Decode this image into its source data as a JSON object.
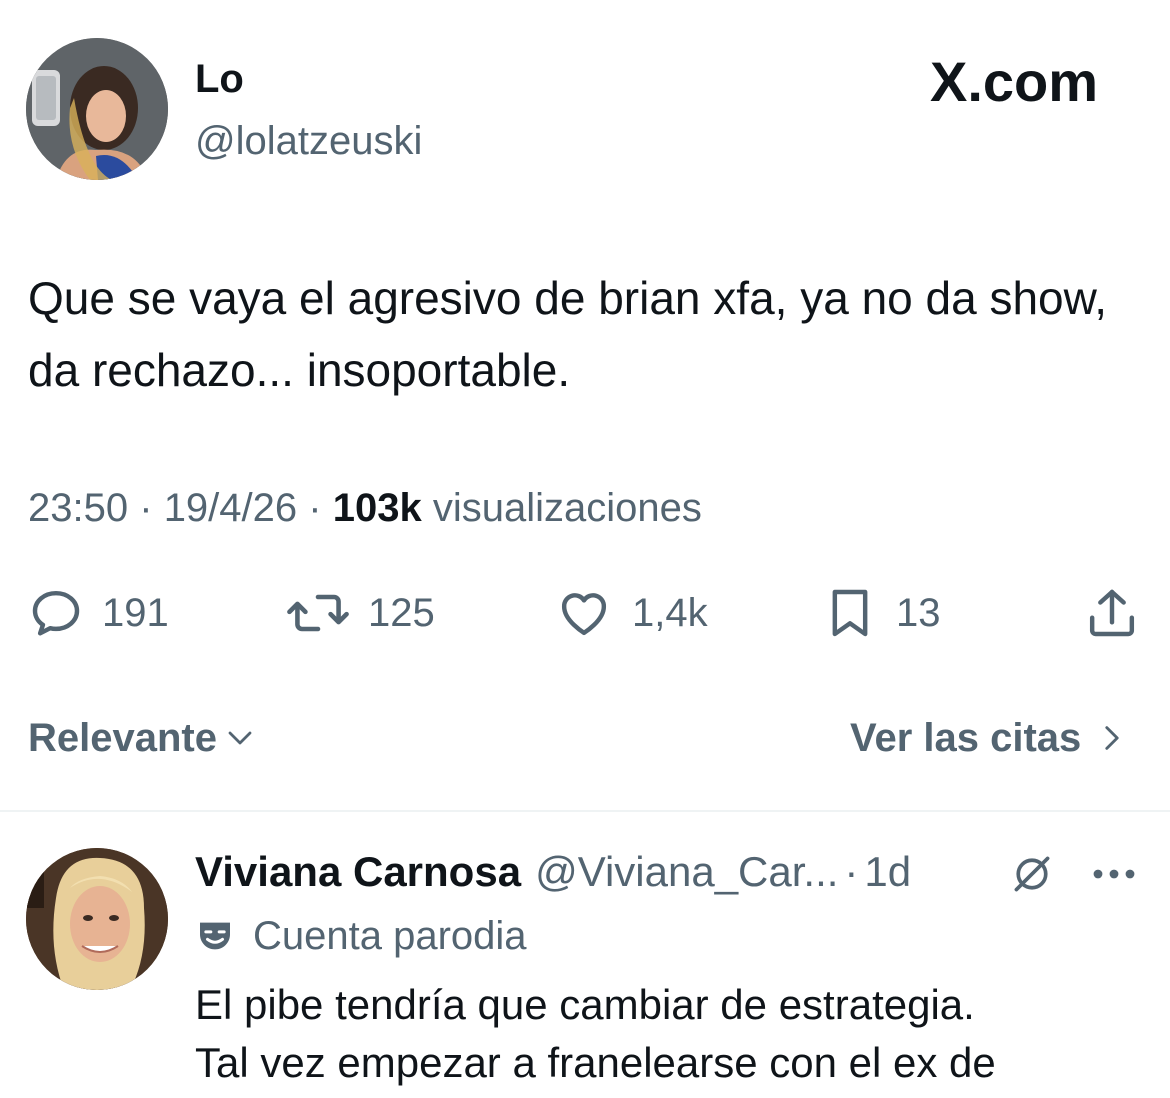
{
  "tweet": {
    "author_name": "Lo",
    "author_handle": "@lolatzeuski",
    "brand": "X.com",
    "text": "Que se vaya el agresivo de brian xfa, ya no da show, da rechazo... insoportable.",
    "time": "23:50",
    "date": "19/4/26",
    "separator": "·",
    "views_count": "103k",
    "views_label": "visualizaciones",
    "actions": {
      "replies": "191",
      "reposts": "125",
      "likes": "1,4k",
      "bookmarks": "13"
    },
    "icons": {
      "reply": "reply-icon",
      "repost": "repost-icon",
      "like": "heart-icon",
      "bookmark": "bookmark-icon",
      "share": "share-icon"
    }
  },
  "replies_bar": {
    "sort_label": "Relevante",
    "quotes_label": "Ver las citas"
  },
  "reply": {
    "author_name": "Viviana Carnosa",
    "author_handle": "@Viviana_Car...",
    "separator": "·",
    "time": "1d",
    "parody_label": "Cuenta parodia",
    "text_line1": "El pibe tendría que cambiar de estrategia.",
    "text_line2": "Tal vez empezar a franelearse con el ex de"
  },
  "colors": {
    "text_primary": "#0f1419",
    "text_secondary": "#536471",
    "divider": "#eff3f4"
  }
}
